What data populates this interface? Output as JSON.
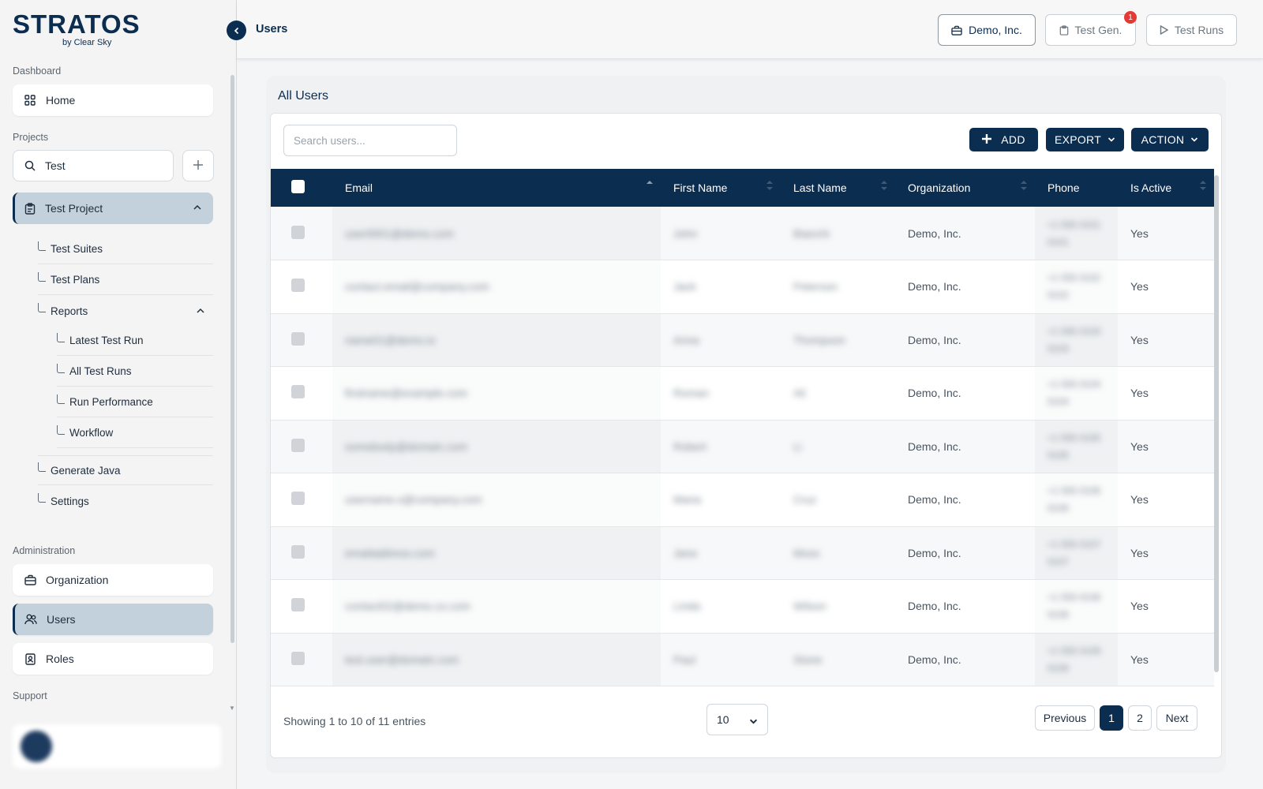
{
  "brand": {
    "name": "STRATOS",
    "tagline": "by Clear Sky"
  },
  "colors": {
    "primary": "#0b2d50",
    "active_bg": "#c3d1dd",
    "badge": "#e53935"
  },
  "sidebar": {
    "dashboard_label": "Dashboard",
    "home_label": "Home",
    "projects_label": "Projects",
    "project_search_value": "Test",
    "project_name": "Test Project",
    "tree": {
      "test_suites": "Test Suites",
      "test_plans": "Test Plans",
      "reports": "Reports",
      "latest_test_run": "Latest Test Run",
      "all_test_runs": "All Test Runs",
      "run_performance": "Run Performance",
      "workflow": "Workflow",
      "generate_java": "Generate Java",
      "settings": "Settings"
    },
    "administration_label": "Administration",
    "organization_label": "Organization",
    "users_label": "Users",
    "roles_label": "Roles",
    "support_label": "Support"
  },
  "header": {
    "title": "Users",
    "org_button": "Demo, Inc.",
    "test_gen_button": "Test Gen.",
    "test_gen_badge": "1",
    "test_runs_button": "Test Runs"
  },
  "main": {
    "panel_title": "All Users",
    "search_placeholder": "Search users...",
    "add_label": "ADD",
    "export_label": "EXPORT",
    "action_label": "ACTION",
    "columns": [
      "Email",
      "First Name",
      "Last Name",
      "Organization",
      "Phone",
      "Is Active"
    ],
    "rows": [
      {
        "email": "user0001@demo.com",
        "first": "John",
        "last": "Bianchi",
        "org": "Demo, Inc.",
        "phone1": "+1 555 0101",
        "phone2": "0101",
        "active": "Yes"
      },
      {
        "email": "contact.email@company.com",
        "first": "Jack",
        "last": "Peterson",
        "org": "Demo, Inc.",
        "phone1": "+1 555 0102",
        "phone2": "0102",
        "active": "Yes"
      },
      {
        "email": "name01@demo.io",
        "first": "Anna",
        "last": "Thompson",
        "org": "Demo, Inc.",
        "phone1": "+1 555 0103",
        "phone2": "0103",
        "active": "Yes"
      },
      {
        "email": "firstname@example.com",
        "first": "Roman",
        "last": "Ali",
        "org": "Demo, Inc.",
        "phone1": "+1 555 0104",
        "phone2": "0104",
        "active": "Yes"
      },
      {
        "email": "somebody@domain.com",
        "first": "Robert",
        "last": "Li",
        "org": "Demo, Inc.",
        "phone1": "+1 555 0105",
        "phone2": "0105",
        "active": "Yes"
      },
      {
        "email": "username.x@company.com",
        "first": "Maria",
        "last": "Cruz",
        "org": "Demo, Inc.",
        "phone1": "+1 555 0106",
        "phone2": "0106",
        "active": "Yes"
      },
      {
        "email": "emailaddress.com",
        "first": "Jane",
        "last": "Moss",
        "org": "Demo, Inc.",
        "phone1": "+1 555 0107",
        "phone2": "0107",
        "active": "Yes"
      },
      {
        "email": "contact02@demo.co.com",
        "first": "Linda",
        "last": "Wilson",
        "org": "Demo, Inc.",
        "phone1": "+1 555 0108",
        "phone2": "0108",
        "active": "Yes"
      },
      {
        "email": "test.user@domain.com",
        "first": "Paul",
        "last": "Stone",
        "org": "Demo, Inc.",
        "phone1": "+1 555 0109",
        "phone2": "0109",
        "active": "Yes"
      }
    ],
    "footer_info": "Showing 1 to 10 of 11 entries",
    "page_size": "10",
    "prev_label": "Previous",
    "page1": "1",
    "page2": "2",
    "next_label": "Next"
  }
}
